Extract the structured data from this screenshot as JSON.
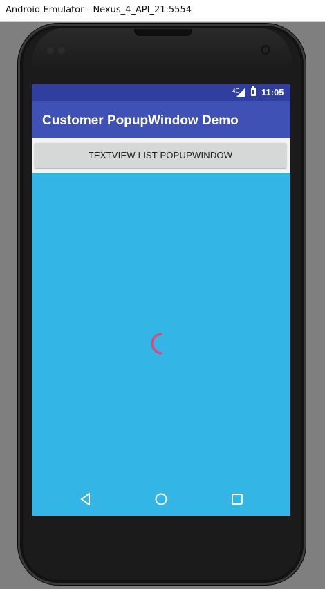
{
  "window": {
    "title": "Android Emulator - Nexus_4_API_21:5554"
  },
  "status_bar": {
    "network": "4G",
    "time": "11:05"
  },
  "app_bar": {
    "title": "Customer PopupWindow Demo"
  },
  "main": {
    "button_label": "TEXTVIEW LIST POPUPWINDOW"
  },
  "nav_bar": {
    "icons": [
      "back-icon",
      "home-icon",
      "recents-icon"
    ]
  },
  "colors": {
    "status_bar": "#303f9f",
    "app_bar": "#3f51b5",
    "content_bg": "#33b5e5",
    "button_bg": "#d6d7d7",
    "spinner": "#e0497b"
  }
}
